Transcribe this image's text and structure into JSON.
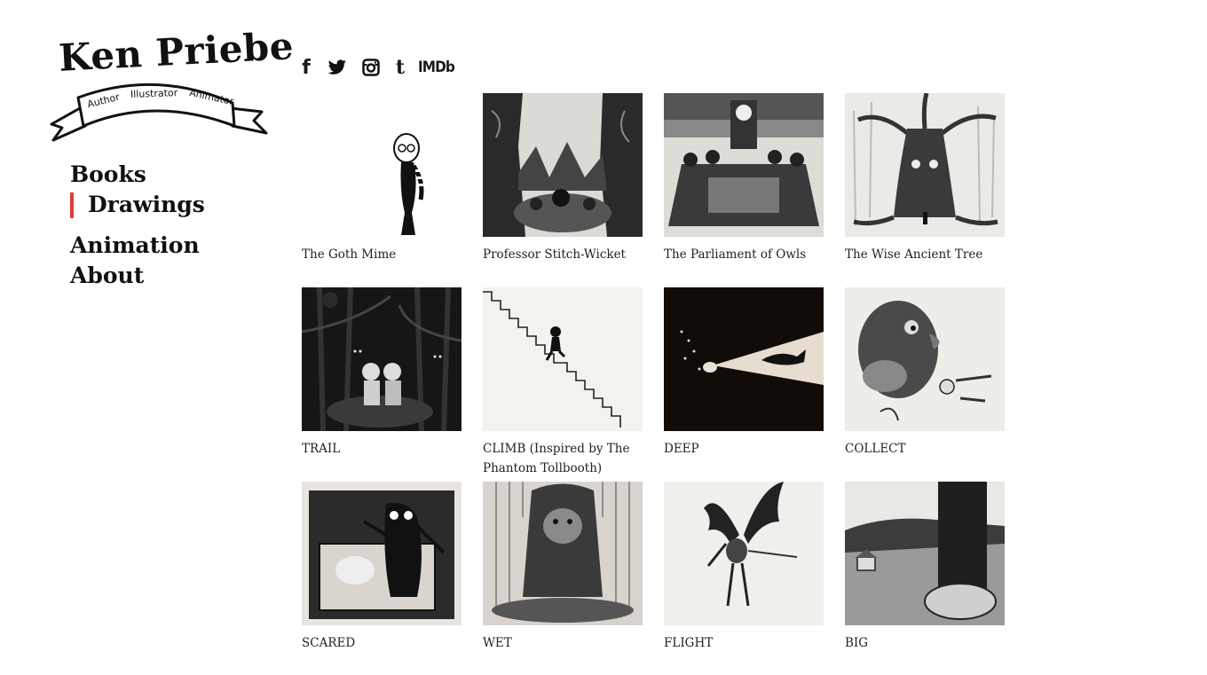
{
  "logo": {
    "title": "Ken Priebe",
    "banner": [
      "Author",
      "Illustrator",
      "Animator"
    ]
  },
  "nav": {
    "items": [
      {
        "label": "Books",
        "active": false
      },
      {
        "label": "Drawings",
        "active": true
      },
      {
        "label": "Animation",
        "active": false
      },
      {
        "label": "About",
        "active": false
      }
    ],
    "active_indicator_color": "#e03a3e"
  },
  "social": {
    "icons": [
      "facebook-icon",
      "twitter-icon",
      "instagram-icon",
      "tumblr-icon"
    ],
    "facebook_glyph": "f",
    "tumblr_glyph": "t",
    "imdb_label": "IMDb"
  },
  "gallery": {
    "items": [
      {
        "caption": "The Goth Mime"
      },
      {
        "caption": "Professor Stitch-Wicket"
      },
      {
        "caption": "The Parliament of Owls"
      },
      {
        "caption": "The Wise Ancient Tree"
      },
      {
        "caption": "TRAIL"
      },
      {
        "caption": "CLIMB (Inspired by The Phantom Tollbooth)"
      },
      {
        "caption": "DEEP"
      },
      {
        "caption": "COLLECT"
      },
      {
        "caption": "SCARED"
      },
      {
        "caption": "WET"
      },
      {
        "caption": "FLIGHT"
      },
      {
        "caption": "BIG"
      }
    ]
  }
}
